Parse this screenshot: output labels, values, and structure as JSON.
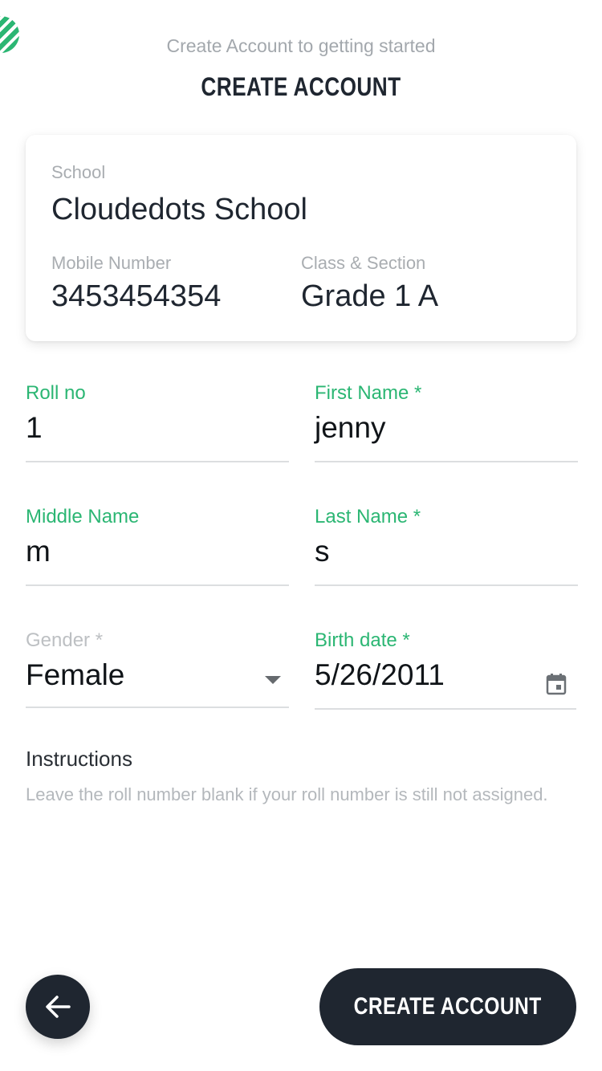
{
  "header": {
    "subtitle": "Create Account to getting started",
    "title": "CREATE ACCOUNT"
  },
  "info_card": {
    "school_label": "School",
    "school_value": "Cloudedots School",
    "mobile_label": "Mobile Number",
    "mobile_value": "3453454354",
    "class_label": "Class & Section",
    "class_value": "Grade 1 A"
  },
  "form": {
    "roll_no": {
      "label": "Roll no",
      "value": "1"
    },
    "first_name": {
      "label": "First Name *",
      "value": "jenny"
    },
    "middle_name": {
      "label": "Middle Name",
      "value": "m"
    },
    "last_name": {
      "label": "Last Name *",
      "value": "s"
    },
    "gender": {
      "label": "Gender *",
      "value": "Female"
    },
    "birth_date": {
      "label": "Birth date *",
      "value": "5/26/2011"
    }
  },
  "instructions": {
    "title": "Instructions",
    "text": "Leave the roll number blank if your roll number is still not assigned."
  },
  "footer": {
    "create_label": "CREATE ACCOUNT"
  },
  "colors": {
    "accent": "#2bb673",
    "dark": "#1f2630",
    "muted": "#a9adb1"
  },
  "icons": {
    "logo": "striped-circle-logo",
    "back": "arrow-left-icon",
    "gender_dropdown": "caret-down-icon",
    "birth_date": "calendar-icon"
  }
}
